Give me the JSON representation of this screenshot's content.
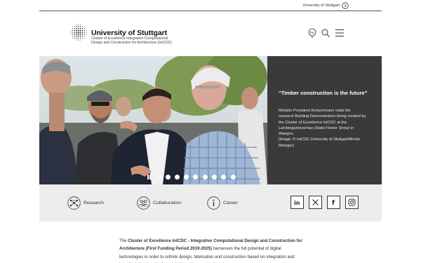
{
  "topbar": {
    "link_label": "University of Stuttgart",
    "icon": "arrow-right-circle-icon"
  },
  "header": {
    "logo_icon": "dotted-sphere-logo",
    "title": "University of Stuttgart",
    "subtitle_line1": "Cluster of Excellence Integrative Computational",
    "subtitle_line2": "Design and Construction for Architecture (IntCDC)",
    "icons": [
      "language-icon",
      "search-icon",
      "menu-icon"
    ]
  },
  "hero": {
    "caption_title": "“Timber construction is the future”",
    "caption_body": "Minister President Kretschmann visits the research Building Demonstrators being created by the Cluster of Excellence IntCDC at the Landesgartenschau (State Flower Show) in Wangen.",
    "caption_credit": "[Image: © IntCDC University of Stuttgart/Moritz Metzger]",
    "slide_count": 9,
    "active_slide": 1,
    "colors": {
      "panel": "#3a3a3a"
    }
  },
  "quicklinks": {
    "items": [
      {
        "label": "Research",
        "icon": "research-network-icon"
      },
      {
        "label": "Collaboration",
        "icon": "collaboration-icon"
      },
      {
        "label": "Career",
        "icon": "info-icon"
      }
    ],
    "social": [
      {
        "label": "in",
        "icon": "linkedin-icon"
      },
      {
        "label": "X",
        "icon": "x-icon"
      },
      {
        "label": "f",
        "icon": "facebook-icon"
      },
      {
        "label": "Instagram",
        "icon": "instagram-icon"
      }
    ]
  },
  "intro": {
    "prefix": "The ",
    "bold": "Cluster of Excellence IntCDC - Integrative Computational Design and Construction for Architecture (First Funding Period 2019-2025)",
    "rest": " harnesses the full potential of digital technologies in order to rethink design, fabrication and construction based on integration and interdisciplinarity with the goal of enabling game-changing"
  }
}
